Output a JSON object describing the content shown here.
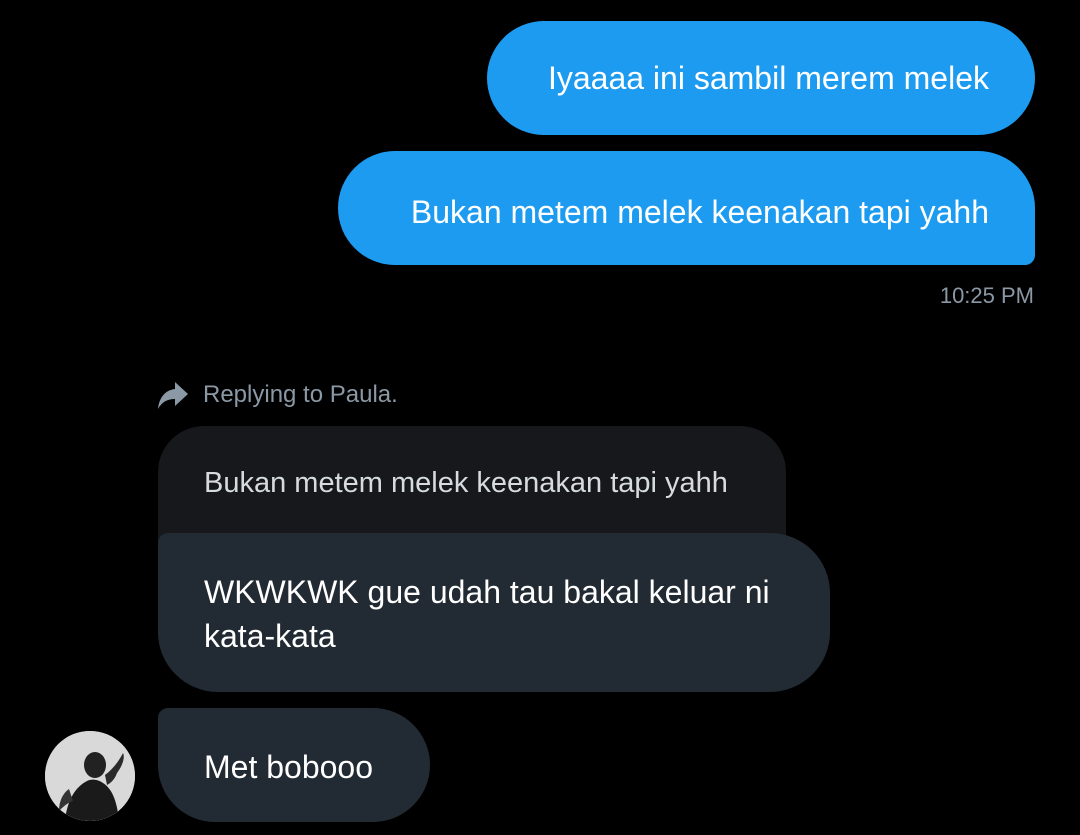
{
  "conversation": {
    "sent_messages": [
      {
        "text": "Iyaaaa ini sambil merem melek"
      },
      {
        "text": "Bukan metem melek keenakan tapi yahh"
      }
    ],
    "sent_timestamp": "10:25 PM",
    "reply_context": {
      "icon": "reply-arrow-icon",
      "label": "Replying to Paula.",
      "quoted_text": "Bukan metem melek keenakan tapi yahh"
    },
    "received_messages": [
      {
        "text": "WKWKWK gue udah tau bakal keluar ni kata-kata"
      },
      {
        "text": "Met bobooo"
      }
    ]
  },
  "colors": {
    "background": "#000000",
    "sent_bubble": "#1d9bf0",
    "received_bubble": "#222b33",
    "quoted_bubble": "#16181c",
    "secondary_text": "#8b98a5"
  }
}
